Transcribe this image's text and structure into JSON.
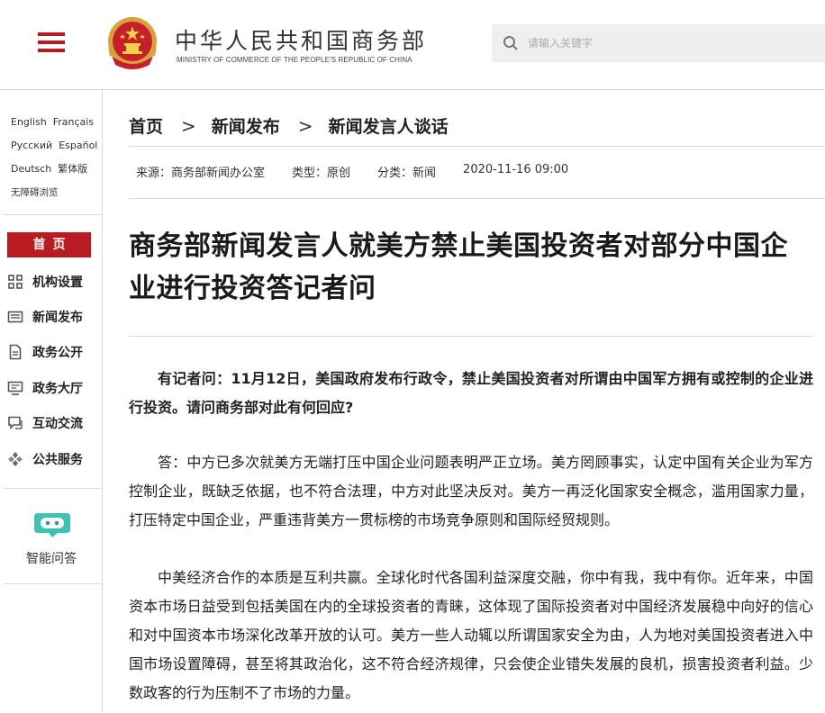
{
  "header": {
    "title_cn": "中华人民共和国商务部",
    "title_en": "MINISTRY OF COMMERCE OF THE PEOPLE'S REPUBLIC OF CHINA",
    "search_placeholder": "请输入关键字"
  },
  "sidebar": {
    "languages": [
      [
        "English",
        "Français"
      ],
      [
        "Русский",
        "Español"
      ],
      [
        "Deutsch",
        "繁体版"
      ]
    ],
    "accessibility": "无障碍浏览",
    "home": "首页",
    "nav": [
      {
        "label": "机构设置",
        "icon": "grid-icon"
      },
      {
        "label": "新闻发布",
        "icon": "newspaper-icon"
      },
      {
        "label": "政务公开",
        "icon": "document-icon"
      },
      {
        "label": "政务大厅",
        "icon": "monitor-icon"
      },
      {
        "label": "互动交流",
        "icon": "chat-icon"
      },
      {
        "label": "公共服务",
        "icon": "service-icon"
      }
    ],
    "smart_qa": "智能问答"
  },
  "breadcrumb": [
    "首页",
    "新闻发布",
    "新闻发言人谈话"
  ],
  "meta": {
    "source": "来源：商务部新闻办公室",
    "type": "类型：原创",
    "category": "分类：新闻",
    "datetime": "2020-11-16 09:00"
  },
  "article": {
    "title": "商务部新闻发言人就美方禁止美国投资者对部分中国企业进行投资答记者问",
    "question": "有记者问：11月12日，美国政府发布行政令，禁止美国投资者对所谓由中国军方拥有或控制的企业进行投资。请问商务部对此有何回应?",
    "answer1": "答：中方已多次就美方无端打压中国企业问题表明严正立场。美方罔顾事实，认定中国有关企业为军方控制企业，既缺乏依据，也不符合法理，中方对此坚决反对。美方一再泛化国家安全概念，滥用国家力量，打压特定中国企业，严重违背美方一贯标榜的市场竞争原则和国际经贸规则。",
    "answer2": "中美经济合作的本质是互利共赢。全球化时代各国利益深度交融，你中有我，我中有你。近年来，中国资本市场日益受到包括美国在内的全球投资者的青睐，这体现了国际投资者对中国经济发展稳中向好的信心和对中国资本市场深化改革开放的认可。美方一些人动辄以所谓国家安全为由，人为地对美国投资者进入中国市场设置障碍，甚至将其政治化，这不符合经济规律，只会使企业错失发展的良机，损害投资者利益。少数政客的行为压制不了市场的力量。"
  },
  "colors": {
    "brand_red": "#b81c22",
    "smart_qa_teal": "#3ec3b0"
  }
}
